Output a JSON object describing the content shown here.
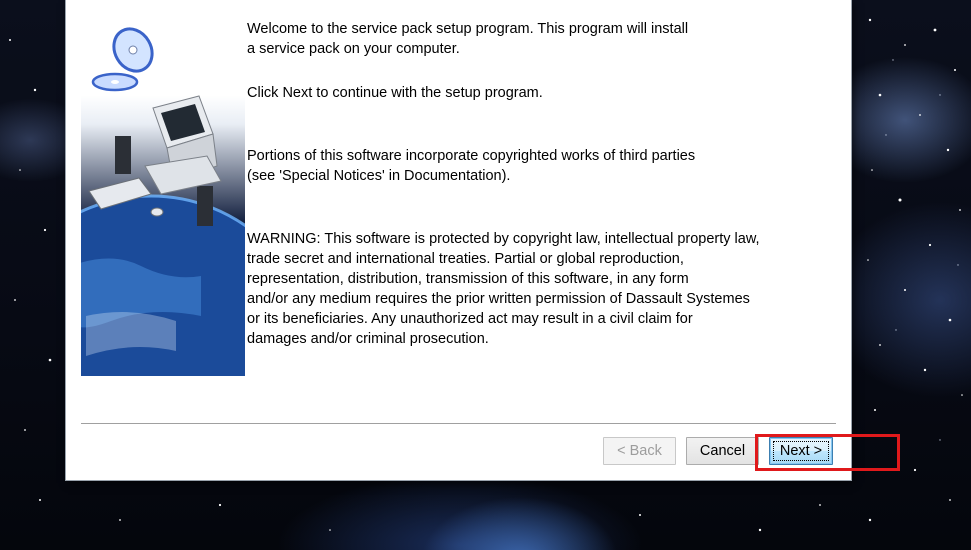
{
  "dialog": {
    "paragraphs": {
      "welcome": [
        "Welcome to the service pack setup program. This program will install",
        "a service pack on your computer."
      ],
      "click_next": [
        "Click Next to continue with the setup program."
      ],
      "portions": [
        "Portions of this software incorporate copyrighted works of third parties",
        "(see 'Special Notices' in Documentation)."
      ],
      "warning": [
        "WARNING: This software is protected by copyright law, intellectual property law,",
        "trade secret and international treaties. Partial or global reproduction,",
        "representation, distribution, transmission of this software, in any form",
        "and/or any medium requires the prior written permission of Dassault Systemes",
        "or its beneficiaries. Any unauthorized act may result in a civil claim for",
        "damages and/or criminal prosecution."
      ]
    },
    "buttons": {
      "back": "< Back",
      "cancel": "Cancel",
      "next": "Next >"
    },
    "states": {
      "back_enabled": false,
      "next_focused": true
    }
  },
  "annotation": {
    "highlight_color": "#e0191b",
    "highlight_target": "next-button"
  },
  "icons": {
    "side_art": [
      "cd-disc-icon",
      "cd-disc-icon",
      "computer-monitor-icon",
      "speaker-icon",
      "keyboard-icon",
      "mouse-icon",
      "planet-earth-icon"
    ]
  }
}
